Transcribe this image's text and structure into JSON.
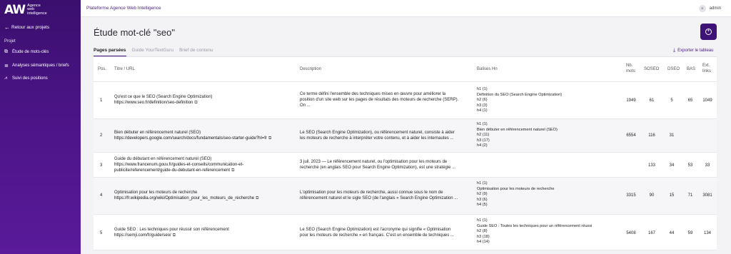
{
  "sidebar": {
    "logo_mark": "AW",
    "logo_lines": [
      "Agence",
      "web",
      "intelligence"
    ],
    "back_label": "Retour aux projets",
    "section_label": "Projet",
    "items": [
      {
        "label": "Étude de mots-clés",
        "icon": "copy-icon"
      },
      {
        "label": "Analyses sémantiques / briefs",
        "icon": "list-icon"
      },
      {
        "label": "Suivi des positions",
        "icon": "chart-icon"
      }
    ]
  },
  "topbar": {
    "title": "Plateforme Agence Web Intelligence",
    "user": "admin",
    "avatar_initial": "a"
  },
  "page": {
    "title": "Étude mot-clé \"seo\"",
    "export_label": "Exporter le tableau"
  },
  "tabs": [
    "Pages parsées",
    "Guide YourTextGuru",
    "Brief de contenu"
  ],
  "table": {
    "headers": {
      "pos": "Pos.",
      "title": "Titre / URL",
      "desc": "Description",
      "hn": "Balises Hn",
      "nbmots": [
        "Nb.",
        "mots"
      ],
      "soseo": "SOSEO",
      "dseo": "DSEO",
      "bas": "BAS",
      "ext": [
        "Ext.",
        "links"
      ]
    },
    "rows": [
      {
        "pos": "1",
        "title": "Qu'est ce que le SEO (Search Engine Optimization)",
        "url": [
          "https://www.seo.fr/definition/seo-definition"
        ],
        "desc": [
          "Ce terme défini l'ensemble des techniques mises en œuvre pour améliorer la",
          "position d'un site web sur les pages de résultats des moteurs de recherche (SERP).",
          "On ..."
        ],
        "hn": [
          "h1 (1)",
          "Définition du SEO (Search Engine Optimization)",
          "h2 (6)",
          "h3 (3)",
          "h4 (1)"
        ],
        "nbmots": "1949",
        "soseo": "61",
        "dseo": "5",
        "bas": "65",
        "ext": "1049"
      },
      {
        "pos": "2",
        "title": "Bien débuter en référencement naturel (SEO)",
        "url": [
          "https://developers.google.com/search/docs/fundamentals/seo-starter-guide?hl=fr"
        ],
        "desc": [
          "Le SEO (Search Engine Optimization), ou référencement naturel, consiste à aider",
          "les moteurs de recherche à interpréter votre contenu, et à aider les internautes ..."
        ],
        "hn": [
          "h1 (1)",
          "Bien débuter en référencement naturel (SEO)",
          "h2 (11)",
          "h3 (17)",
          "h4 (2)"
        ],
        "nbmots": "6554",
        "soseo": "116",
        "dseo": "31",
        "bas": "",
        "ext": ""
      },
      {
        "pos": "3",
        "title": "Guide du débutant en référencement naturel (SEO)",
        "url": [
          "https://www.francenum.gouv.fr/guides-et-conseils/communication-et-",
          "publicite/referencement/guide-du-debutant-en-referencement"
        ],
        "desc": [
          "3 juil. 2023 — Le référencement naturel, ou l'optimisation pour les moteurs de",
          "recherche (en anglais SEO pour Search Engine Optimization), est une stratégie ..."
        ],
        "hn": [],
        "nbmots": "",
        "soseo": "133",
        "dseo": "34",
        "bas": "53",
        "ext": "33"
      },
      {
        "pos": "4",
        "title": "Optimisation pour les moteurs de recherche",
        "url": [
          "https://fr.wikipedia.org/wiki/Optimisation_pour_les_moteurs_de_recherche"
        ],
        "desc": [
          "L'optimisation pour les moteurs de recherche, aussi connue sous le nom de",
          "référencement naturel et le sigle SEO (de l'anglais « Search Engine Optimization ..."
        ],
        "hn": [
          "h1 (1)",
          "Optimisation pour les moteurs de recherche",
          "h2 (9)",
          "h3 (6)",
          "h4 (5)"
        ],
        "nbmots": "3315",
        "soseo": "90",
        "dseo": "15",
        "bas": "71",
        "ext": "3081"
      },
      {
        "pos": "5",
        "title": "Guide SEO : Les techniques pour réussir son référencement",
        "url": [
          "https://semji.com/fr/guide/seo/"
        ],
        "desc": [
          "Le SEO (Search Engine Optimization) est l'acronyme qui signifie « Optimisation",
          "pour les moteurs de recherche » en français. C'est un ensemble de techniques ..."
        ],
        "hn": [
          "h1 (1)",
          "Guide SEO : Toutes les techniques pour un référencement réussi",
          "h2 (8)",
          "h3 (18)",
          "h4 (14)"
        ],
        "nbmots": "5408",
        "soseo": "167",
        "dseo": "44",
        "bas": "59",
        "ext": "134"
      }
    ]
  }
}
